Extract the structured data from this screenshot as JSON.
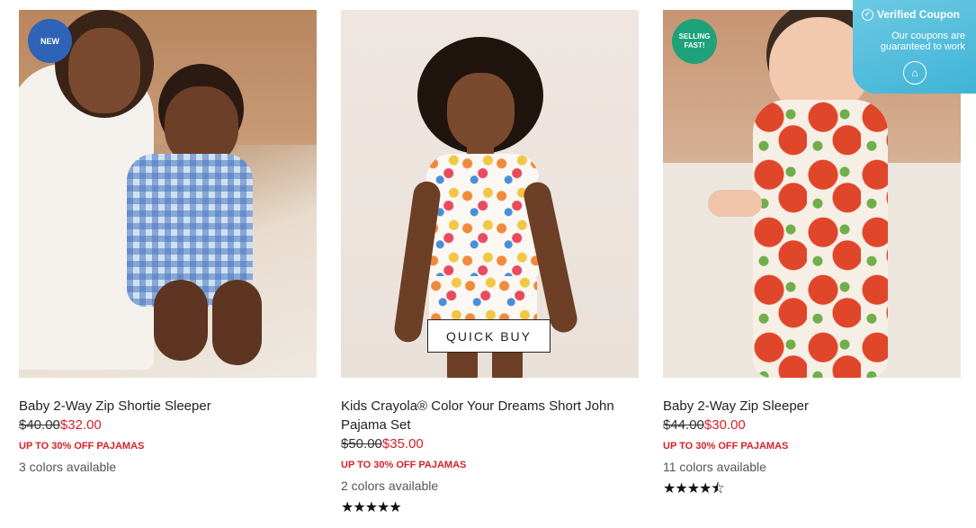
{
  "products": [
    {
      "badge": "NEW",
      "title": "Baby 2-Way Zip Shortie Sleeper",
      "price_old": "$40.00",
      "price_new": "$32.00",
      "promo": "UP TO 30% OFF PAJAMAS",
      "colors": "3 colors available",
      "rating": null
    },
    {
      "badge": "",
      "quick_buy": "QUICK BUY",
      "title": "Kids Crayola® Color Your Dreams Short John Pajama Set",
      "price_old": "$50.00",
      "price_new": "$35.00",
      "promo": "UP TO 30% OFF PAJAMAS",
      "colors": "2 colors available",
      "rating": 5
    },
    {
      "badge": "SELLING FAST!",
      "title": "Baby 2-Way Zip Sleeper",
      "price_old": "$44.00",
      "price_new": "$30.00",
      "promo": "UP TO 30% OFF PAJAMAS",
      "colors": "11 colors available",
      "rating": 4.5
    }
  ],
  "coupon_widget": {
    "title": "Verified Coupon",
    "subtitle": "Our coupons are guaranteed to work",
    "icon": "home-icon"
  },
  "colors": {
    "sale_red": "#d3232c",
    "badge_new": "#2e63b8",
    "badge_selling": "#1fa27a",
    "coupon_bg": "#4bbfe0"
  }
}
